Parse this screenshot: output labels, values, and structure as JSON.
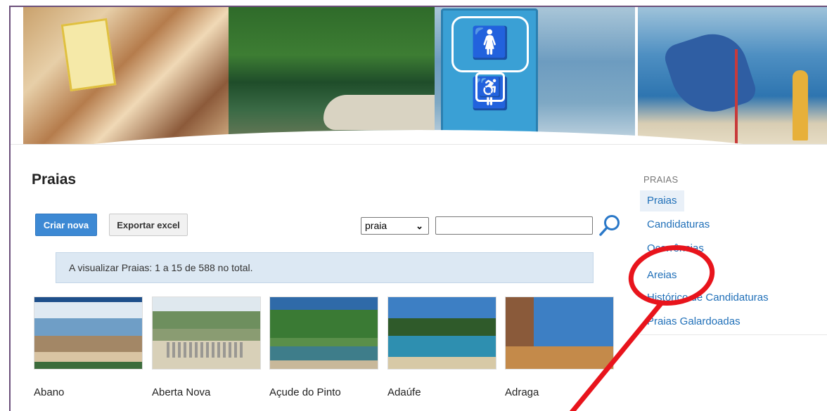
{
  "page": {
    "title": "Praias"
  },
  "toolbar": {
    "create_label": "Criar nova",
    "export_label": "Exportar excel",
    "search_field_selected": "praia",
    "search_value": ""
  },
  "info": {
    "message": "A visualizar Praias: 1 a 15 de 588 no total."
  },
  "beaches": [
    {
      "name": "Abano"
    },
    {
      "name": "Aberta Nova"
    },
    {
      "name": "Açude do Pinto"
    },
    {
      "name": "Adaúfe"
    },
    {
      "name": "Adraga"
    }
  ],
  "sidebar": {
    "heading": "PRAIAS",
    "items": [
      {
        "label": "Praias",
        "active": true
      },
      {
        "label": "Candidaturas",
        "active": false
      },
      {
        "label": "Ocorrências",
        "active": false
      },
      {
        "label": "Areias",
        "active": false
      },
      {
        "label": "Histórico de Candidaturas",
        "active": false
      },
      {
        "label": "Praias Galardoadas",
        "active": false
      }
    ]
  },
  "annotation": {
    "color": "#e8141c",
    "shapes": [
      "highlight-circle",
      "pointer-arrow"
    ]
  },
  "colors": {
    "primary_button": "#3d89d4",
    "link": "#1f6fb8",
    "info_bg": "#dce8f3"
  }
}
